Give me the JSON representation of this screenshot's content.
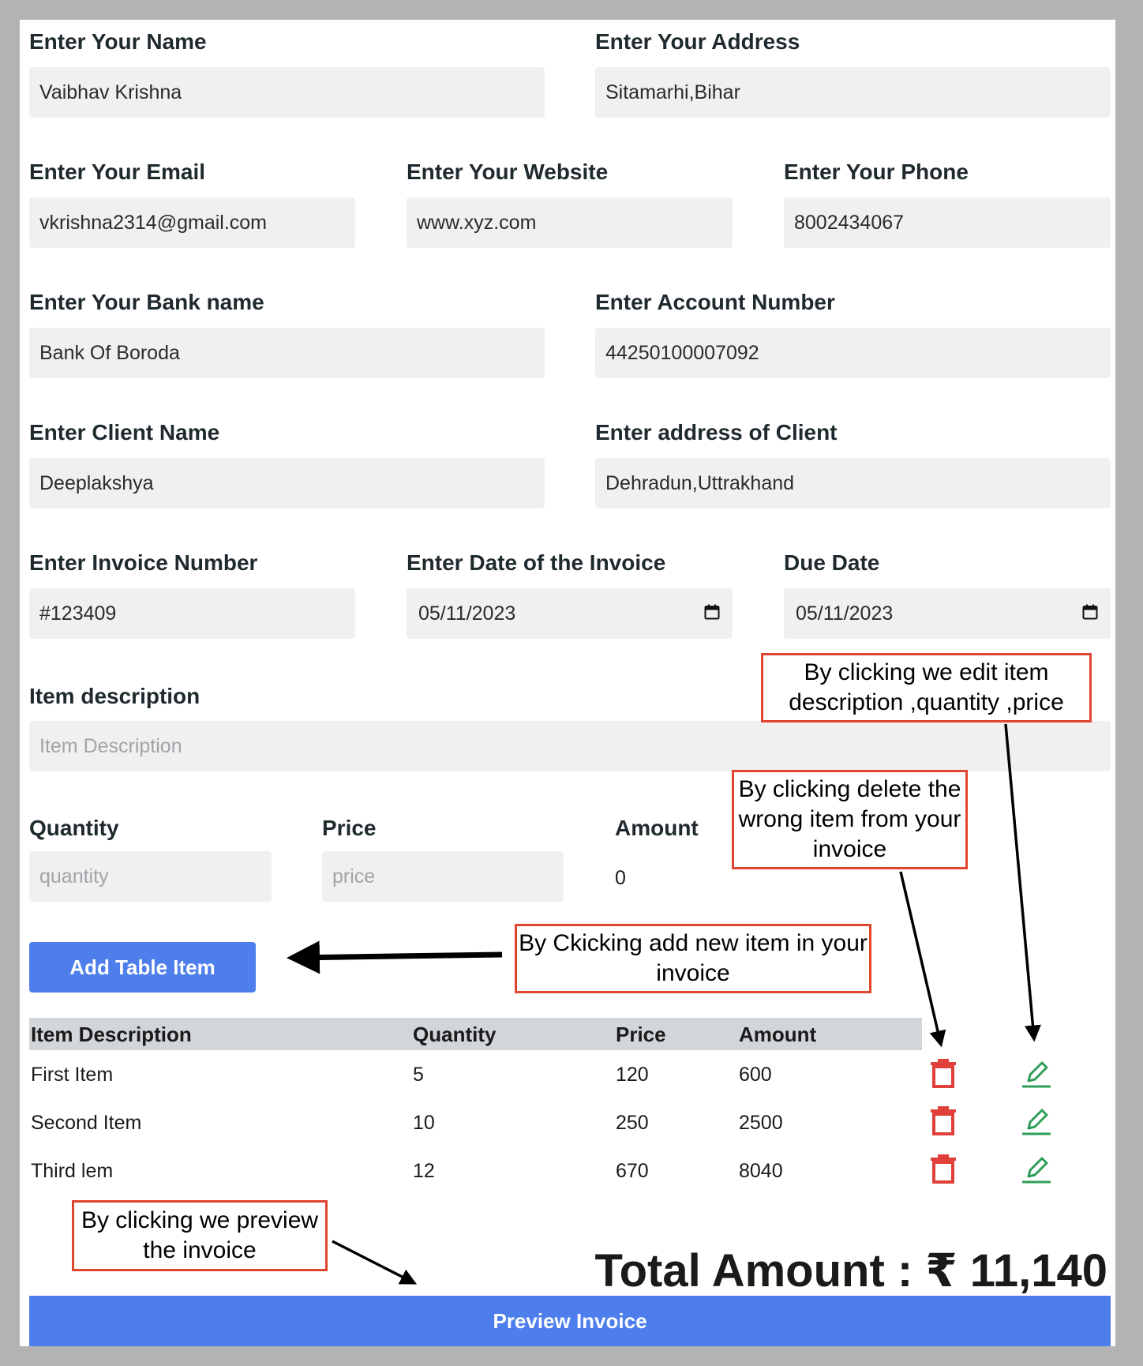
{
  "form": {
    "name": {
      "label": "Enter Your Name",
      "value": "Vaibhav Krishna"
    },
    "address": {
      "label": "Enter Your Address",
      "value": "Sitamarhi,Bihar"
    },
    "email": {
      "label": "Enter Your Email",
      "value": "vkrishna2314@gmail.com"
    },
    "website": {
      "label": "Enter Your Website",
      "value": "www.xyz.com"
    },
    "phone": {
      "label": "Enter Your Phone",
      "value": "8002434067"
    },
    "bank": {
      "label": "Enter Your Bank name",
      "value": "Bank Of Boroda"
    },
    "account": {
      "label": "Enter Account Number",
      "value": "44250100007092"
    },
    "client_name": {
      "label": "Enter Client Name",
      "value": "Deeplakshya"
    },
    "client_address": {
      "label": "Enter address of Client",
      "value": "Dehradun,Uttrakhand"
    },
    "invoice_number": {
      "label": "Enter Invoice Number",
      "value": "#123409"
    },
    "invoice_date": {
      "label": "Enter Date of the Invoice",
      "value": "05/11/2023"
    },
    "due_date": {
      "label": "Due Date",
      "value": "05/11/2023"
    },
    "item_description": {
      "label": "Item description",
      "placeholder": "Item Description"
    },
    "quantity": {
      "label": "Quantity",
      "placeholder": "quantity"
    },
    "price": {
      "label": "Price",
      "placeholder": "price"
    },
    "amount": {
      "label": "Amount",
      "value": "0"
    }
  },
  "buttons": {
    "add_item": "Add Table Item",
    "preview": "Preview Invoice"
  },
  "table": {
    "headers": [
      "Item Description",
      "Quantity",
      "Price",
      "Amount"
    ],
    "rows": [
      {
        "description": "First Item",
        "quantity": "5",
        "price": "120",
        "amount": "600"
      },
      {
        "description": "Second Item",
        "quantity": "10",
        "price": "250",
        "amount": "2500"
      },
      {
        "description": "Third lem",
        "quantity": "12",
        "price": "670",
        "amount": "8040"
      }
    ]
  },
  "total": {
    "label": "Total Amount :",
    "currency": "₹",
    "value": "11,140"
  },
  "annotations": {
    "edit": "By clicking we edit item description ,quantity ,price",
    "delete": "By clicking delete the wrong item from your invoice",
    "add": "By Ckicking  add new item in your invoice",
    "preview": "By clicking we preview the invoice"
  },
  "colors": {
    "accent": "#4d7eeb",
    "delete": "#e0403a",
    "edit": "#2e9e58",
    "annotation_border": "#e04530"
  },
  "icons": {
    "calendar": "calendar-icon",
    "delete": "trash-icon",
    "edit": "pencil-icon"
  }
}
